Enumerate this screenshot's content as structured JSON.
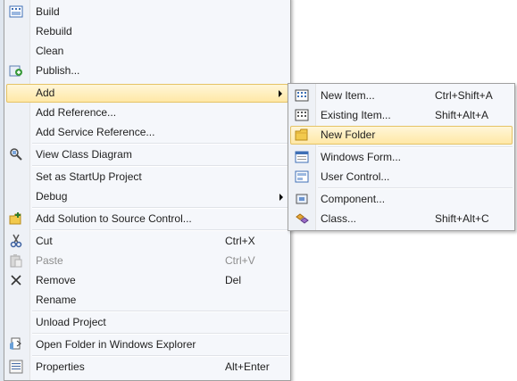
{
  "context_menu": {
    "build": "Build",
    "rebuild": "Rebuild",
    "clean": "Clean",
    "publish": "Publish...",
    "add": "Add",
    "add_reference": "Add Reference...",
    "add_service_reference": "Add Service Reference...",
    "view_class_diagram": "View Class Diagram",
    "set_startup": "Set as StartUp Project",
    "debug": "Debug",
    "add_solution_source_control": "Add Solution to Source Control...",
    "cut": "Cut",
    "cut_shortcut": "Ctrl+X",
    "paste": "Paste",
    "paste_shortcut": "Ctrl+V",
    "remove": "Remove",
    "remove_shortcut": "Del",
    "rename": "Rename",
    "unload_project": "Unload Project",
    "open_folder": "Open Folder in Windows Explorer",
    "properties": "Properties",
    "properties_shortcut": "Alt+Enter"
  },
  "add_submenu": {
    "new_item": "New Item...",
    "new_item_shortcut": "Ctrl+Shift+A",
    "existing_item": "Existing Item...",
    "existing_item_shortcut": "Shift+Alt+A",
    "new_folder": "New Folder",
    "windows_form": "Windows Form...",
    "user_control": "User Control...",
    "component": "Component...",
    "class": "Class...",
    "class_shortcut": "Shift+Alt+C"
  }
}
